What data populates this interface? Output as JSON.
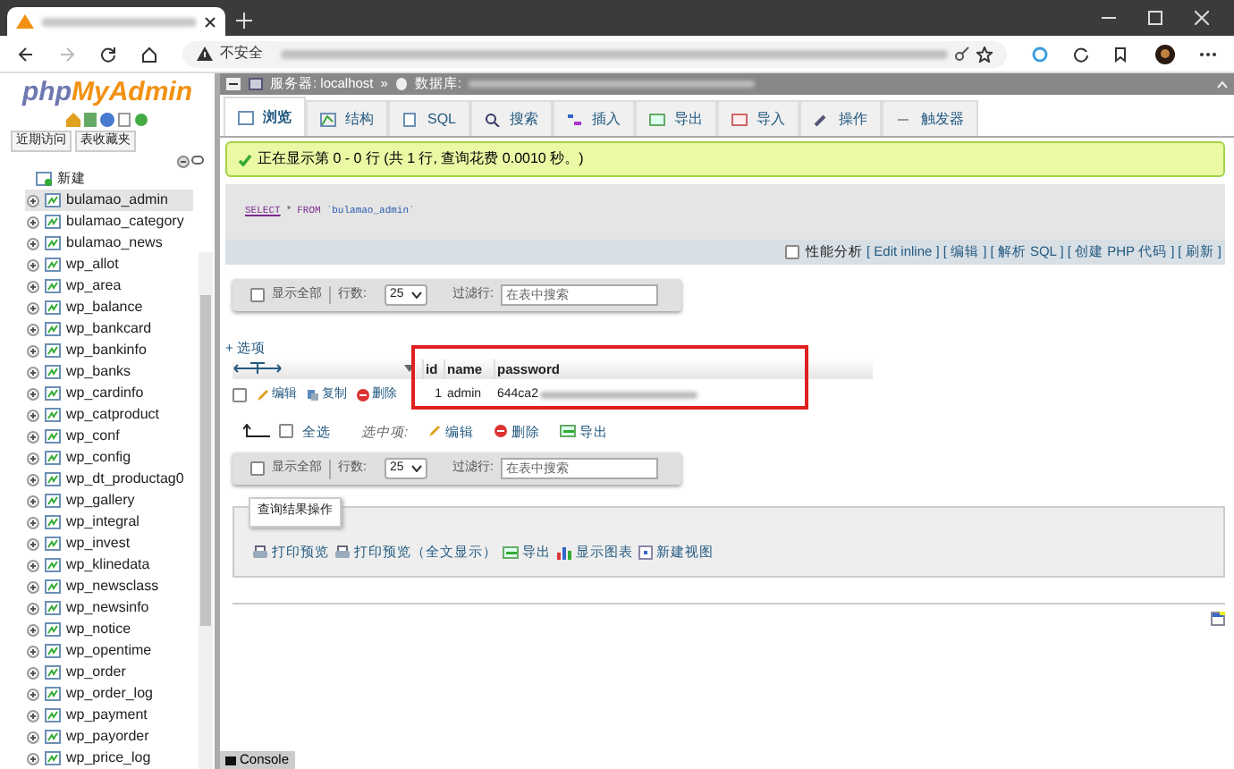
{
  "browser": {
    "security_label": "不安全"
  },
  "sidebar": {
    "logo_php": "php",
    "logo_name": "MyAdmin",
    "buttons": [
      "近期访问",
      "表收藏夹"
    ],
    "new_item": "新建",
    "tables": [
      {
        "name": "bulamao_admin",
        "selected": true
      },
      {
        "name": "bulamao_category",
        "selected": false
      },
      {
        "name": "bulamao_news",
        "selected": false
      },
      {
        "name": "wp_allot",
        "selected": false
      },
      {
        "name": "wp_area",
        "selected": false
      },
      {
        "name": "wp_balance",
        "selected": false
      },
      {
        "name": "wp_bankcard",
        "selected": false
      },
      {
        "name": "wp_bankinfo",
        "selected": false
      },
      {
        "name": "wp_banks",
        "selected": false
      },
      {
        "name": "wp_cardinfo",
        "selected": false
      },
      {
        "name": "wp_catproduct",
        "selected": false
      },
      {
        "name": "wp_conf",
        "selected": false
      },
      {
        "name": "wp_config",
        "selected": false
      },
      {
        "name": "wp_dt_productag0",
        "selected": false
      },
      {
        "name": "wp_gallery",
        "selected": false
      },
      {
        "name": "wp_integral",
        "selected": false
      },
      {
        "name": "wp_invest",
        "selected": false
      },
      {
        "name": "wp_klinedata",
        "selected": false
      },
      {
        "name": "wp_newsclass",
        "selected": false
      },
      {
        "name": "wp_newsinfo",
        "selected": false
      },
      {
        "name": "wp_notice",
        "selected": false
      },
      {
        "name": "wp_opentime",
        "selected": false
      },
      {
        "name": "wp_order",
        "selected": false
      },
      {
        "name": "wp_order_log",
        "selected": false
      },
      {
        "name": "wp_payment",
        "selected": false
      },
      {
        "name": "wp_payorder",
        "selected": false
      },
      {
        "name": "wp_price_log",
        "selected": false
      }
    ]
  },
  "breadcrumb": {
    "server": "服务器: localhost",
    "separator": "»",
    "database_label": "数据库:"
  },
  "tabs": [
    {
      "label": "浏览",
      "selected": true
    },
    {
      "label": "结构",
      "selected": false
    },
    {
      "label": "SQL",
      "selected": false
    },
    {
      "label": "搜索",
      "selected": false
    },
    {
      "label": "插入",
      "selected": false
    },
    {
      "label": "导出",
      "selected": false
    },
    {
      "label": "导入",
      "selected": false
    },
    {
      "label": "操作",
      "selected": false
    },
    {
      "label": "触发器",
      "selected": false
    }
  ],
  "success_message": "正在显示第 0 - 0 行 (共 1 行, 查询花费 0.0010 秒。)",
  "sql": {
    "keyword1": "SELECT",
    "star": "*",
    "keyword2": "FROM",
    "table": "`bulamao_admin`"
  },
  "sql_links": {
    "profiling": {
      "label": "性能分析",
      "checked": false
    },
    "links": [
      "[ Edit inline ]",
      "[ 编辑 ]",
      "[ 解析 SQL ]",
      "[ 创建 PHP 代码 ]",
      "[ 刷新 ]"
    ]
  },
  "nav_bars": [
    {
      "show_all": "显示全部",
      "show_all_checked": false,
      "rows_label": "行数:",
      "rows_value": "25",
      "filter_label": "过滤行:",
      "filter_placeholder": "在表中搜索"
    },
    {
      "show_all": "显示全部",
      "show_all_checked": false,
      "rows_label": "行数:",
      "rows_value": "25",
      "filter_label": "过滤行:",
      "filter_placeholder": "在表中搜索"
    }
  ],
  "options_link": "+ 选项",
  "table": {
    "columns": [
      "id",
      "name",
      "password"
    ],
    "rows": [
      {
        "checked": false,
        "actions": [
          "编辑",
          "复制",
          "删除"
        ],
        "cells": [
          "1",
          "admin",
          "644ca2"
        ]
      }
    ]
  },
  "bulk": {
    "check_all": "全选",
    "checked": false,
    "with_selected": "选中项:",
    "actions": [
      "编辑",
      "删除",
      "导出"
    ]
  },
  "query_ops": {
    "legend": "查询结果操作",
    "actions": [
      "打印预览",
      "打印预览（全文显示）",
      "导出",
      "显示图表",
      "新建视图"
    ]
  },
  "console": "Console"
}
